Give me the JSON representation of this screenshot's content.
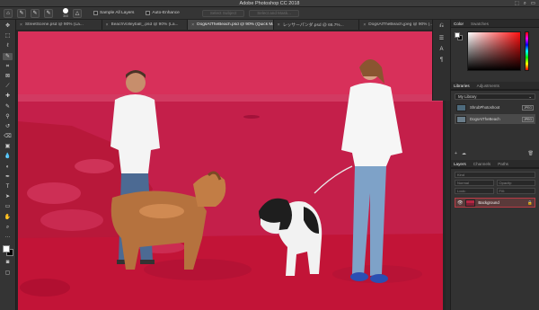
{
  "window": {
    "title": "Adobe Photoshop CC 2018",
    "controls": [
      "⬚",
      "⌕",
      "▭"
    ]
  },
  "options_bar": {
    "brush_size": "300",
    "sample_all_layers": "Sample All Layers",
    "auto_enhance": "Auto-Enhance",
    "select_subject": "Select Subject",
    "select_and_mask": "Select and Mask..."
  },
  "tabs": [
    {
      "label": "StreetScene.psd @ 90% (La...",
      "active": false
    },
    {
      "label": "BeachVolleyball_.psd @ 90% (La...",
      "active": false
    },
    {
      "label": "DogsAtTheBeach.psd @ 90% (Quick Mask/8) *",
      "active": true
    },
    {
      "label": "レッサーパンダ.psd @ 66.7%...",
      "active": false
    },
    {
      "label": "DogsAtTheBeach.jpeg @ 90% (...",
      "active": false
    }
  ],
  "color_panel": {
    "tabs": [
      "Color",
      "Swatches"
    ],
    "colors": {
      "foreground": "#ffffff",
      "background": "#000000",
      "hue": "#ff1010"
    }
  },
  "libraries_panel": {
    "tabs": [
      "Libraries",
      "Adjustments"
    ],
    "library_name": "My Library",
    "items": [
      {
        "name": "ShrubPhotoshoot",
        "format": "JPEG"
      },
      {
        "name": "DogsAtTheBeach",
        "format": "JPEG"
      }
    ]
  },
  "layers_panel": {
    "tabs": [
      "Layers",
      "Channels",
      "Paths"
    ],
    "kind_placeholder": "Kind",
    "blend_mode": "Normal",
    "opacity": "Opacity:",
    "lock": "Lock:",
    "fill": "Fill:",
    "layer": {
      "name": "Background"
    }
  },
  "canvas": {
    "quick_mask_color": "#d7284a"
  }
}
